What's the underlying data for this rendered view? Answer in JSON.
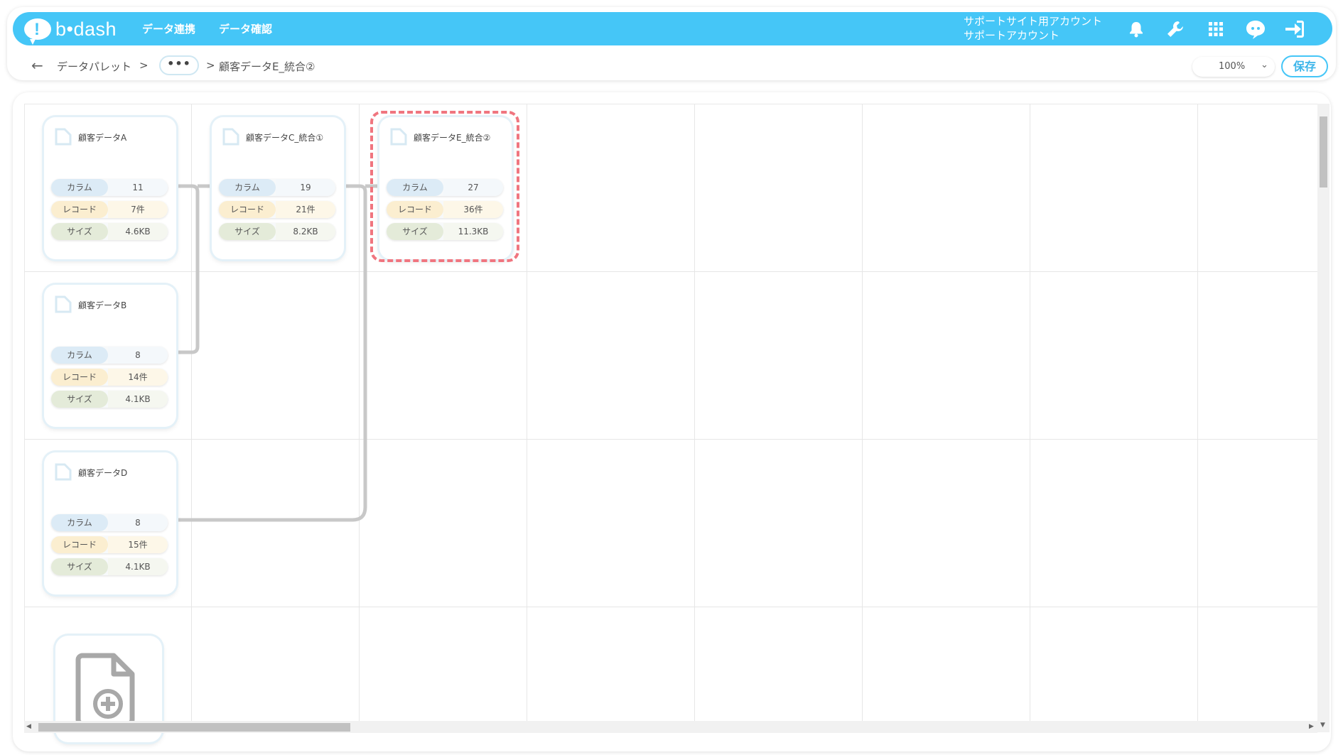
{
  "header": {
    "logo_text": "b•dash",
    "nav": [
      "データ連携",
      "データ確認"
    ],
    "account_line1": "サポートサイト用アカウント",
    "account_line2": "サポートアカウント",
    "icons": [
      "bell-icon",
      "wrench-icon",
      "grid-icon",
      "chat-bot-icon",
      "logout-icon"
    ]
  },
  "breadcrumb": {
    "back": "←",
    "root": "データパレット",
    "sep1": ">",
    "more": "•••",
    "sep2": ">",
    "current": "顧客データE_統合②"
  },
  "toolbar": {
    "zoom": "100%",
    "save_label": "保存"
  },
  "labels": {
    "column": "カラム",
    "record": "レコード",
    "size": "サイズ"
  },
  "cards": [
    {
      "title": "顧客データA",
      "columns": "11",
      "records": "7件",
      "size": "4.6KB"
    },
    {
      "title": "顧客データB",
      "columns": "8",
      "records": "14件",
      "size": "4.1KB"
    },
    {
      "title": "顧客データD",
      "columns": "8",
      "records": "15件",
      "size": "4.1KB"
    },
    {
      "title": "顧客データC_統合①",
      "columns": "19",
      "records": "21件",
      "size": "8.2KB"
    },
    {
      "title": "顧客データE_統合②",
      "columns": "27",
      "records": "36件",
      "size": "11.3KB",
      "selected": true
    }
  ],
  "colors": {
    "brand": "#45c6f7",
    "selected_outline": "#f0757f",
    "connector": "#c8c8c8"
  }
}
